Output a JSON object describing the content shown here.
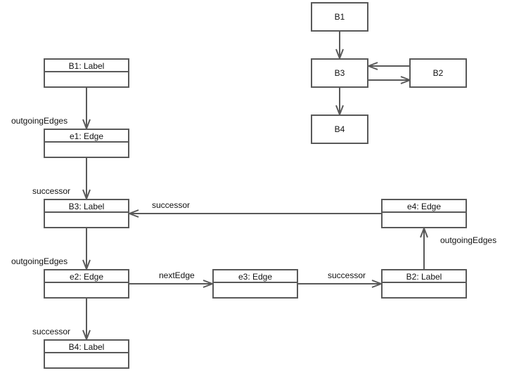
{
  "object_diagram": {
    "objects": [
      {
        "id": "b1",
        "title": "B1: Label"
      },
      {
        "id": "e1",
        "title": "e1: Edge"
      },
      {
        "id": "b3",
        "title": "B3: Label"
      },
      {
        "id": "e2",
        "title": "e2: Edge"
      },
      {
        "id": "b4",
        "title": "B4: Label"
      },
      {
        "id": "e3",
        "title": "e3: Edge"
      },
      {
        "id": "b2",
        "title": "B2: Label"
      },
      {
        "id": "e4",
        "title": "e4: Edge"
      }
    ],
    "links": [
      {
        "from": "b1",
        "to": "e1",
        "label": "outgoingEdges"
      },
      {
        "from": "e1",
        "to": "b3",
        "label": "successor"
      },
      {
        "from": "b3",
        "to": "e2",
        "label": "outgoingEdges"
      },
      {
        "from": "e2",
        "to": "b4",
        "label": "successor"
      },
      {
        "from": "e2",
        "to": "e3",
        "label": "nextEdge"
      },
      {
        "from": "e3",
        "to": "b2",
        "label": "successor"
      },
      {
        "from": "b2",
        "to": "e4",
        "label": "outgoingEdges"
      },
      {
        "from": "e4",
        "to": "b3",
        "label": "successor"
      }
    ]
  },
  "cfg": {
    "nodes": [
      {
        "id": "B1",
        "label": "B1"
      },
      {
        "id": "B3",
        "label": "B3"
      },
      {
        "id": "B2",
        "label": "B2"
      },
      {
        "id": "B4",
        "label": "B4"
      }
    ],
    "edges": [
      {
        "from": "B1",
        "to": "B3"
      },
      {
        "from": "B3",
        "to": "B2"
      },
      {
        "from": "B2",
        "to": "B3"
      },
      {
        "from": "B3",
        "to": "B4"
      }
    ]
  }
}
